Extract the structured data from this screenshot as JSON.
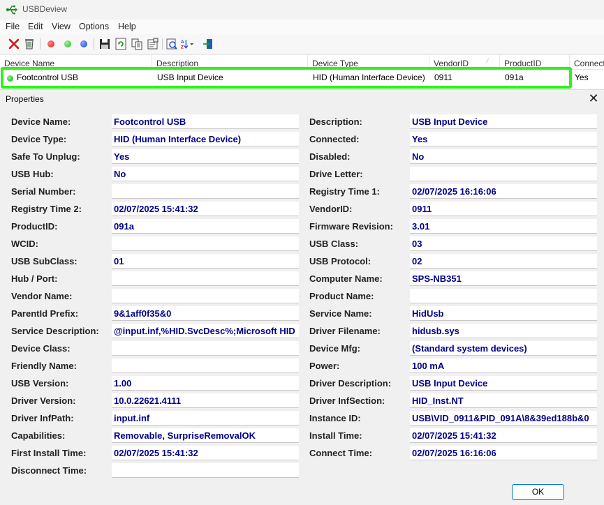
{
  "window": {
    "title": "USBDeview"
  },
  "menu": [
    "File",
    "Edit",
    "View",
    "Options",
    "Help"
  ],
  "toolbar": {
    "icons": [
      "disconnect-icon",
      "uninstall-icon",
      "red-dot-icon",
      "green-dot-icon",
      "blue-dot-icon",
      "save-icon",
      "refresh-icon",
      "copy-icon",
      "properties-icon",
      "find-icon",
      "sort-icon",
      "exit-icon"
    ],
    "colors": {
      "red": "#e01818",
      "green": "#1fb51f",
      "blue": "#1a3fd6"
    }
  },
  "list": {
    "columns": [
      "Device Name",
      "Description",
      "Device Type",
      "VendorID",
      "ProductID",
      "Connected"
    ],
    "rows": [
      {
        "status_color": "#1ba51b",
        "cells": [
          "Footcontrol USB",
          "USB Input Device",
          "HID (Human Interface Device)",
          "0911",
          "091a",
          "Yes"
        ]
      }
    ],
    "highlight_color": "#33ee22"
  },
  "dialog": {
    "title": "Properties",
    "left": [
      {
        "label": "Device Name:",
        "value": "Footcontrol USB"
      },
      {
        "label": "Device Type:",
        "value": "HID (Human Interface Device)"
      },
      {
        "label": "Safe To Unplug:",
        "value": "Yes"
      },
      {
        "label": "USB Hub:",
        "value": "No"
      },
      {
        "label": "Serial Number:",
        "value": ""
      },
      {
        "label": "Registry Time 2:",
        "value": "02/07/2025 15:41:32"
      },
      {
        "label": "ProductID:",
        "value": "091a"
      },
      {
        "label": "WCID:",
        "value": ""
      },
      {
        "label": "USB SubClass:",
        "value": "01"
      },
      {
        "label": "Hub / Port:",
        "value": ""
      },
      {
        "label": "Vendor Name:",
        "value": ""
      },
      {
        "label": "ParentId Prefix:",
        "value": "9&1aff0f35&0"
      },
      {
        "label": "Service Description:",
        "value": "@input.inf,%HID.SvcDesc%;Microsoft HID"
      },
      {
        "label": "Device Class:",
        "value": ""
      },
      {
        "label": "Friendly Name:",
        "value": ""
      },
      {
        "label": "USB Version:",
        "value": "1.00"
      },
      {
        "label": "Driver Version:",
        "value": "10.0.22621.4111"
      },
      {
        "label": "Driver InfPath:",
        "value": "input.inf"
      },
      {
        "label": "Capabilities:",
        "value": "Removable, SurpriseRemovalOK"
      },
      {
        "label": "First Install Time:",
        "value": "02/07/2025 15:41:32"
      },
      {
        "label": "Disconnect Time:",
        "value": ""
      }
    ],
    "right": [
      {
        "label": "Description:",
        "value": "USB Input Device"
      },
      {
        "label": "Connected:",
        "value": "Yes"
      },
      {
        "label": "Disabled:",
        "value": "No"
      },
      {
        "label": "Drive Letter:",
        "value": ""
      },
      {
        "label": "Registry Time 1:",
        "value": "02/07/2025 16:16:06"
      },
      {
        "label": "VendorID:",
        "value": "0911"
      },
      {
        "label": "Firmware Revision:",
        "value": "3.01"
      },
      {
        "label": "USB Class:",
        "value": "03"
      },
      {
        "label": "USB Protocol:",
        "value": "02"
      },
      {
        "label": "Computer Name:",
        "value": "SPS-NB351"
      },
      {
        "label": "Product Name:",
        "value": ""
      },
      {
        "label": "Service Name:",
        "value": "HidUsb"
      },
      {
        "label": "Driver Filename:",
        "value": "hidusb.sys"
      },
      {
        "label": "Device Mfg:",
        "value": "(Standard system devices)"
      },
      {
        "label": "Power:",
        "value": "100 mA"
      },
      {
        "label": "Driver Description:",
        "value": "USB Input Device"
      },
      {
        "label": "Driver InfSection:",
        "value": "HID_Inst.NT"
      },
      {
        "label": "Instance ID:",
        "value": "USB\\VID_0911&PID_091A\\8&39ed188b&0"
      },
      {
        "label": "Install Time:",
        "value": "02/07/2025 15:41:32"
      },
      {
        "label": "Connect Time:",
        "value": "02/07/2025 16:16:06"
      }
    ],
    "ok_label": "OK"
  }
}
